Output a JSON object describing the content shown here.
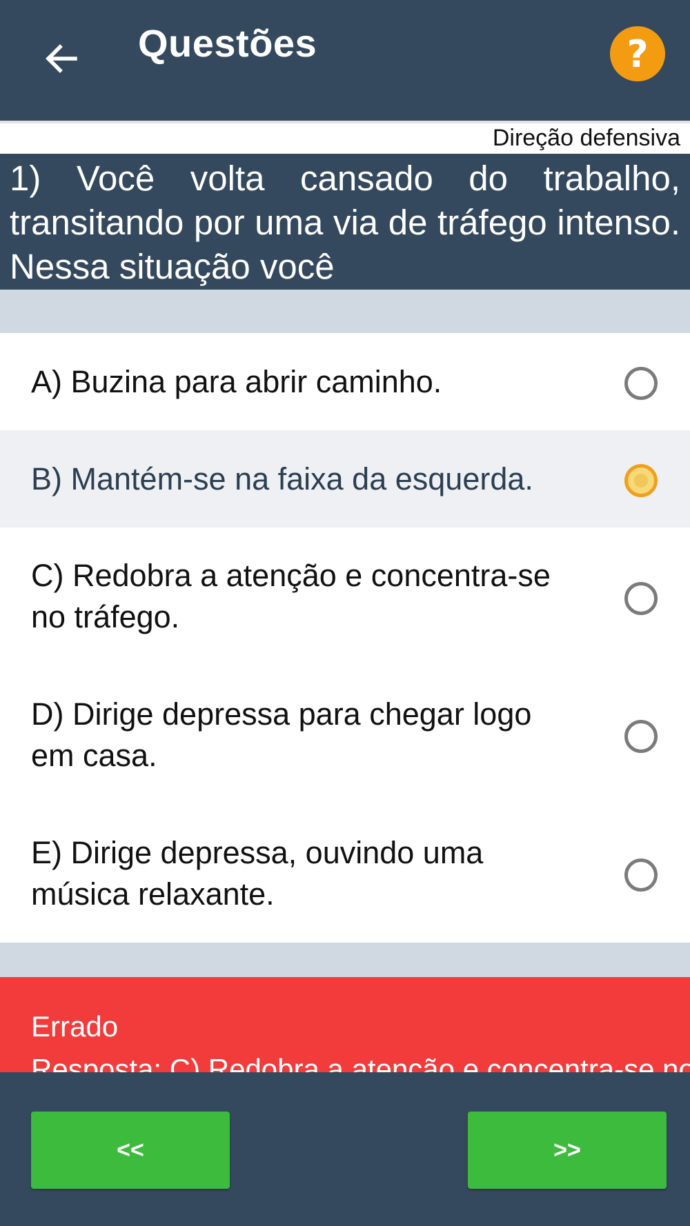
{
  "header": {
    "title": "Questões",
    "back_icon": "arrow-left-icon",
    "help_label": "?",
    "help_color": "#f39c12"
  },
  "category": "Direção defensiva",
  "question": {
    "text": "1) Você volta cansado do trabalho, transitando por uma via de tráfego intenso. Nessa situação você"
  },
  "options": [
    {
      "label": "A) Buzina para abrir caminho.",
      "selected": false
    },
    {
      "label": "B) Mantém-se na faixa da esquerda.",
      "selected": true
    },
    {
      "label": "C) Redobra a atenção e concentra-se no tráfego.",
      "selected": false
    },
    {
      "label": "D) Dirige depressa para chegar logo em casa.",
      "selected": false
    },
    {
      "label": "E) Dirige depressa, ouvindo uma música relaxante.",
      "selected": false
    }
  ],
  "result": {
    "status": "Errado",
    "answer": "Resposta: C) Redobra a atenção e concentra-se no",
    "color": "#f23c3c"
  },
  "navigation": {
    "prev_label": "<<",
    "next_label": ">>",
    "button_color": "#3dbb3d"
  },
  "colors": {
    "primary": "#34495e",
    "selected_radio": "#f0a020"
  }
}
